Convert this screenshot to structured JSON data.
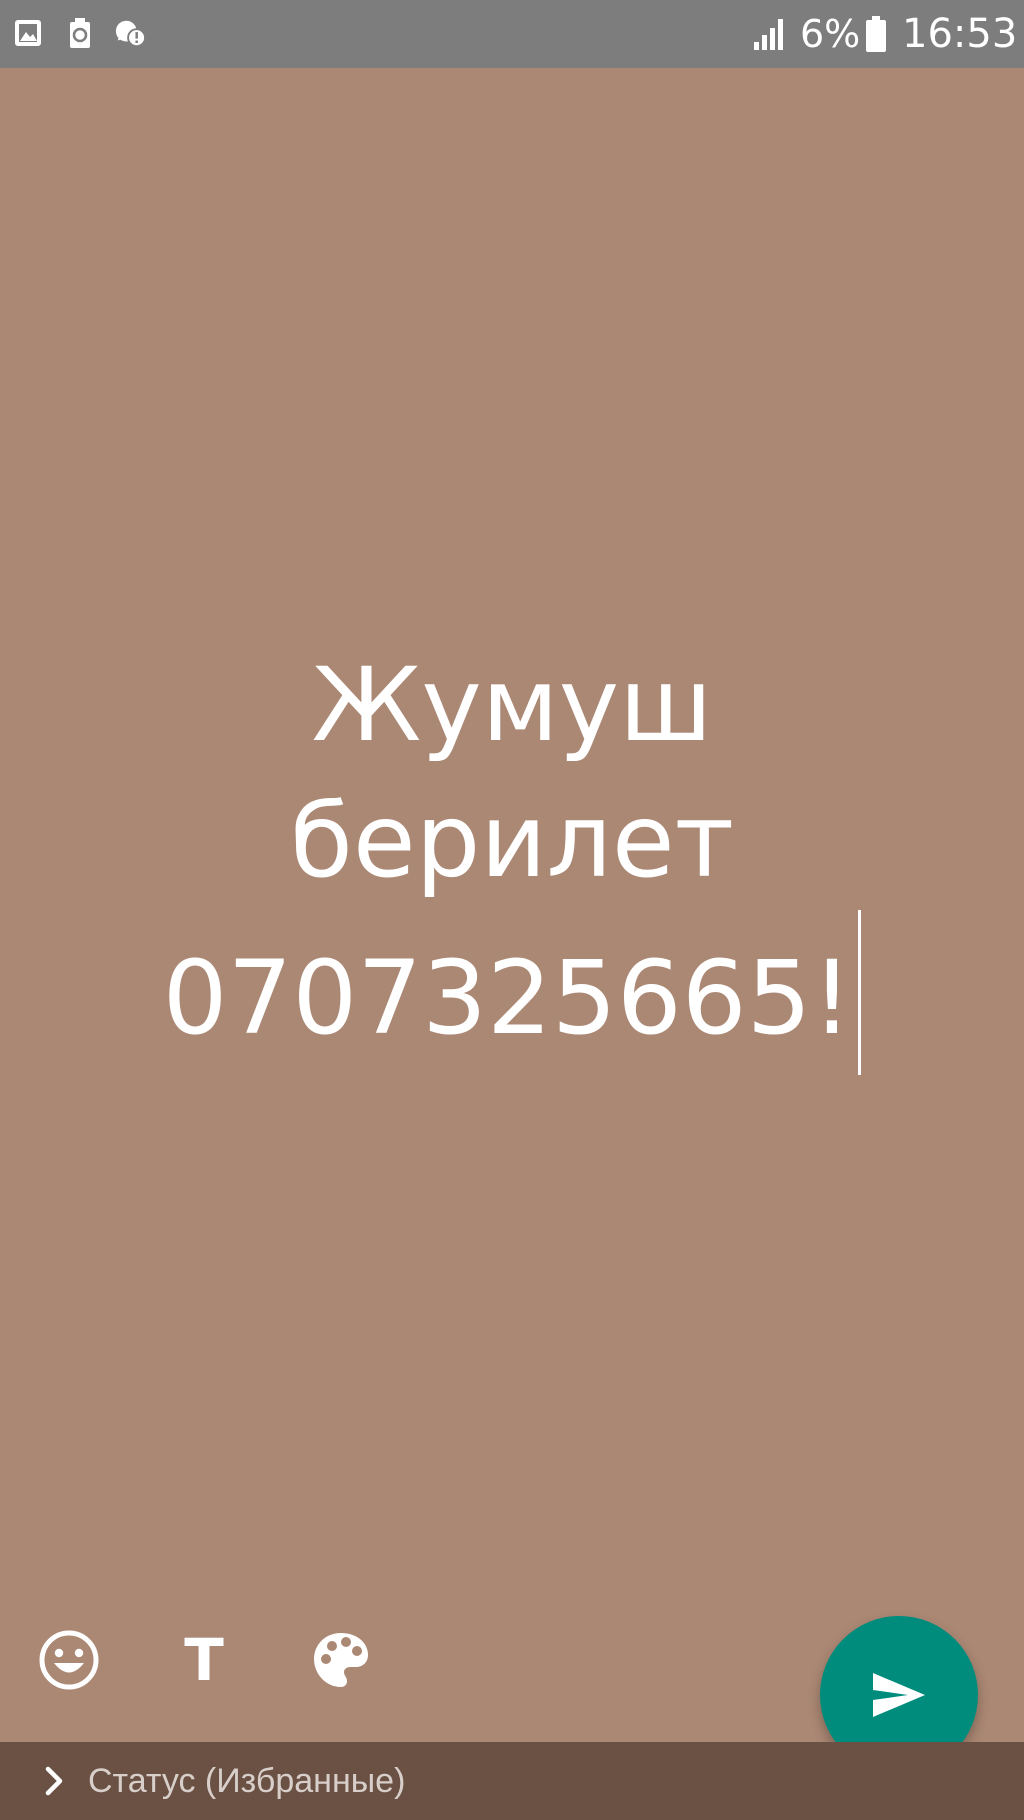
{
  "status_bar": {
    "icons": [
      "image-icon",
      "battery-saver-icon",
      "whatsapp-alert-icon"
    ],
    "signal_icon": "signal-bars-icon",
    "battery_percent": "6%",
    "battery_icon": "battery-icon",
    "time": "16:53"
  },
  "composer": {
    "background_color": "#ab8874",
    "text_lines": [
      "Жумуш",
      "берилет",
      "0707325665!"
    ]
  },
  "toolbar": {
    "emoji_icon": "emoji-smile-icon",
    "font_label": "T",
    "palette_icon": "palette-icon"
  },
  "send": {
    "icon": "send-icon",
    "color": "#008c7d"
  },
  "audience": {
    "chevron_icon": "chevron-right-icon",
    "label": "Статус (Избранные)"
  }
}
